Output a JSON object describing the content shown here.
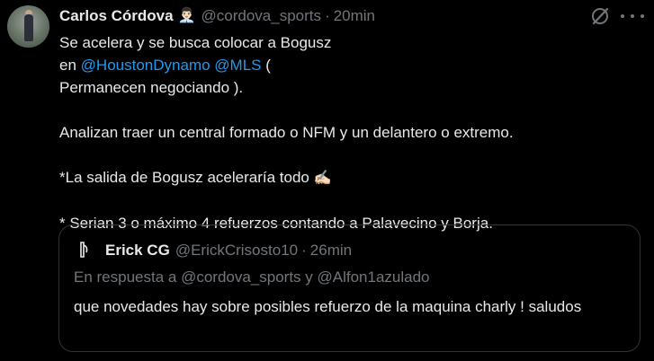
{
  "tweet": {
    "author": {
      "display_name": "Carlos Córdova",
      "badge_emoji": "👨🏻‍💼",
      "handle": "@cordova_sports",
      "separator": "·",
      "time": "20min"
    },
    "icons": {
      "grok": "grok-icon",
      "more": "more-icon"
    },
    "body": {
      "line1_pre": "Se acelera y se busca colocar a Bogusz",
      "flag": "poland-flag-icon",
      "line1_en": "en",
      "mention1": "@HoustonDynamo",
      "mention2": "@MLS",
      "line1_post": "(",
      "line2": "Permanecen negociando ).",
      "paragraph2": "Analizan traer un central formado o NFM y un delantero o extremo.",
      "paragraph3": "*La salida de Bogusz aceleraría todo",
      "paragraph3_emoji": "✍🏻",
      "paragraph4": "* Serian 3 o máximo 4 refuerzos contando a  Palavecino y Borja."
    },
    "quoted": {
      "author_name": "Erick CG",
      "handle": "@ErickCrisosto10",
      "separator": "·",
      "time": "26min",
      "replying_to": "En respuesta a @cordova_sports y @Alfon1azulado",
      "text": "que novedades hay sobre posibles refuerzo de la maquina charly ! saludos"
    }
  },
  "colors": {
    "background": "#000000",
    "text": "#e7e9ea",
    "secondary": "#71767b",
    "link": "#1d9bf0",
    "border": "#2f3336"
  }
}
